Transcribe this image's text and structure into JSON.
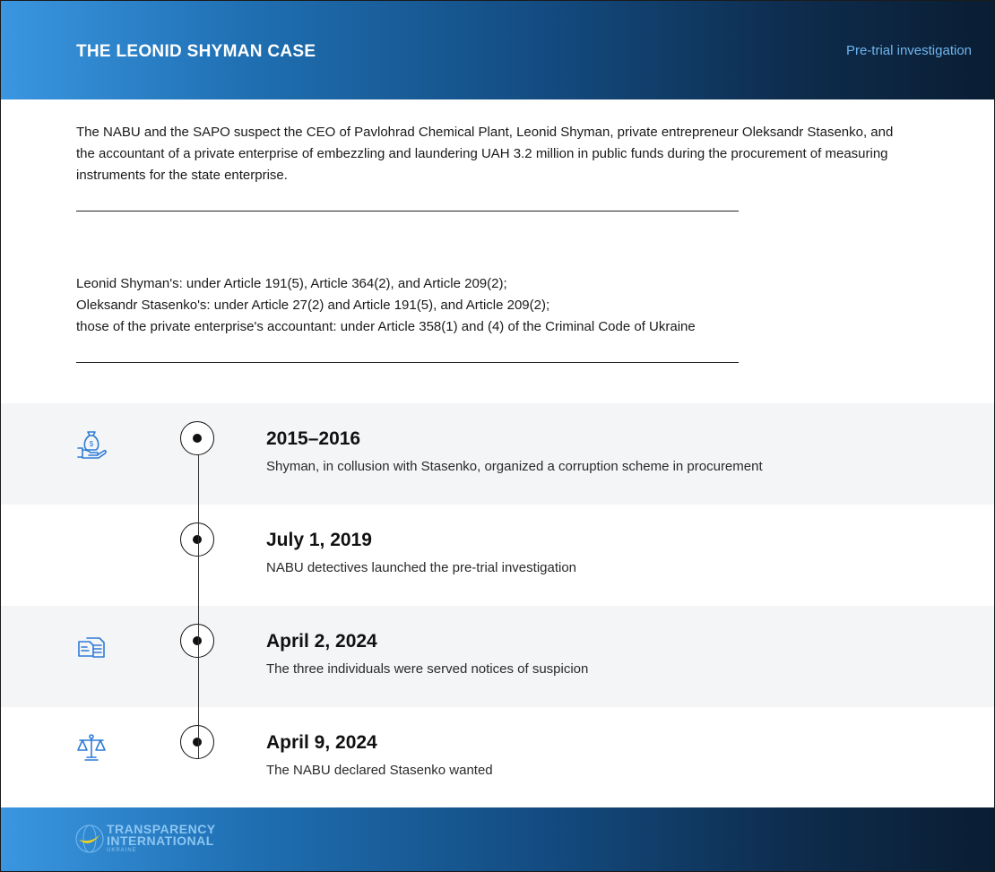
{
  "header": {
    "title": "THE LEONID SHYMAN CASE",
    "stage": "Pre-trial investigation"
  },
  "intro": {
    "text": "The NABU and the SAPO suspect the CEO of Pavlohrad Chemical Plant, Leonid Shyman, private entrepreneur Oleksandr Stasenko, and the accountant of a private enterprise of embezzling and laundering UAH 3.2 million in public funds during the procurement of measuring instruments for the state enterprise."
  },
  "charges": [
    "Leonid Shyman's: under Article 191(5), Article 364(2), and Article 209(2);",
    "Oleksandr Stasenko's: under Article 27(2) and Article 191(5), and Article 209(2);",
    "those of the private enterprise's accountant: under Article 358(1) and (4) of the Criminal Code of Ukraine"
  ],
  "timeline": [
    {
      "date": "2015–2016",
      "description": "Shyman, in collusion with Stasenko, organized a corruption scheme in procurement",
      "icon": "money-bag-hand-icon"
    },
    {
      "date": "July 1, 2019",
      "description": "NABU detectives launched the pre-trial investigation",
      "icon": ""
    },
    {
      "date": "April 2, 2024",
      "description": "The three individuals were served notices of suspicion",
      "icon": "documents-icon"
    },
    {
      "date": "April 9, 2024",
      "description": "The NABU declared Stasenko wanted",
      "icon": "scales-icon"
    }
  ],
  "footer": {
    "logo_line1": "TRANSPARENCY",
    "logo_line2": "INTERNATIONAL",
    "logo_line3": "UKRAINE"
  },
  "colors": {
    "accent": "#3a96e0",
    "header_dark": "#0a1d33",
    "icon_blue": "#2e7bd6",
    "logo_yellow": "#f5d31a"
  }
}
